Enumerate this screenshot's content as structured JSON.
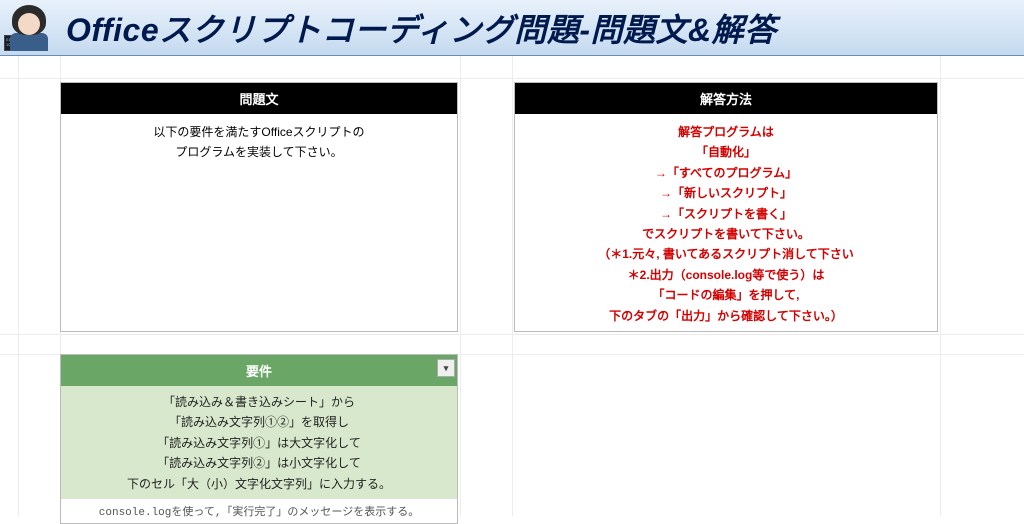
{
  "header": {
    "title": "Officeスクリプトコーディング問題-問題文&解答"
  },
  "left_panel": {
    "heading": "問題文",
    "line1": "以下の要件を満たすOfficeスクリプトの",
    "line2": "プログラムを実装して下さい。"
  },
  "right_panel": {
    "heading": "解答方法",
    "lines": [
      "解答プログラムは",
      "「自動化」",
      "→「すべてのプログラム」",
      "→「新しいスクリプト」",
      "→「スクリプトを書く」",
      "でスクリプトを書いて下さい。",
      "（＊1.元々, 書いてあるスクリプト消して下さい",
      "＊2.出力（console.log等で使う）は",
      "「コードの編集」を押して,",
      "下のタブの「出力」から確認して下さい。）"
    ]
  },
  "requirements": {
    "heading": "要件",
    "lines": [
      "「読み込み＆書き込みシート」から",
      "「読み込み文字列①②」を取得し",
      "「読み込み文字列①」は大文字化して",
      "「読み込み文字列②」は小文字化して",
      "下のセル「大（小）文字化文字列」に入力する。"
    ],
    "note": "console.logを使って,「実行完了」のメッセージを表示する。"
  }
}
